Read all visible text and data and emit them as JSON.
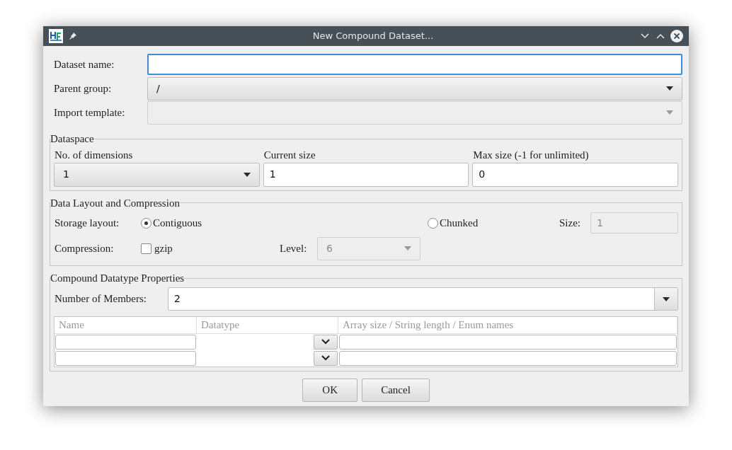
{
  "window": {
    "title": "New Compound Dataset..."
  },
  "form": [
    {
      "label": "Dataset name:",
      "kind": "input",
      "focused": true
    },
    {
      "label": "Parent group:",
      "kind": "dropdown",
      "value": "/",
      "disabled": false
    },
    {
      "label": "Import template:",
      "kind": "dropdown",
      "disabled": true
    }
  ],
  "dataspace": {
    "title": "Dataspace",
    "columns": [
      {
        "label": "No. of dimensions",
        "kind": "dropdown",
        "value": "1"
      },
      {
        "label": "Current size",
        "kind": "input",
        "value": "1"
      },
      {
        "label": "Max size (-1 for unlimited)",
        "kind": "input",
        "value": "0"
      }
    ]
  },
  "layout": {
    "title": "Data Layout and Compression",
    "storage_label": "Storage layout:",
    "options": [
      {
        "label": "Contiguous",
        "selected": true
      },
      {
        "label": "Chunked",
        "selected": false
      }
    ],
    "size_label": "Size:",
    "size_value": "1",
    "size_disabled": true,
    "compression_label": "Compression:",
    "gzip": {
      "label": "gzip",
      "checked": false
    },
    "level_label": "Level:",
    "level_value": "6",
    "level_disabled": true
  },
  "compound": {
    "title": "Compound Datatype Properties",
    "members_label": "Number of Members:",
    "members_value": "2",
    "columns": [
      "Name",
      "Datatype",
      "Array size / String length / Enum names"
    ],
    "rows": [
      {
        "kind": "member"
      },
      {
        "kind": "member"
      }
    ]
  },
  "buttons": [
    "OK",
    "Cancel"
  ]
}
